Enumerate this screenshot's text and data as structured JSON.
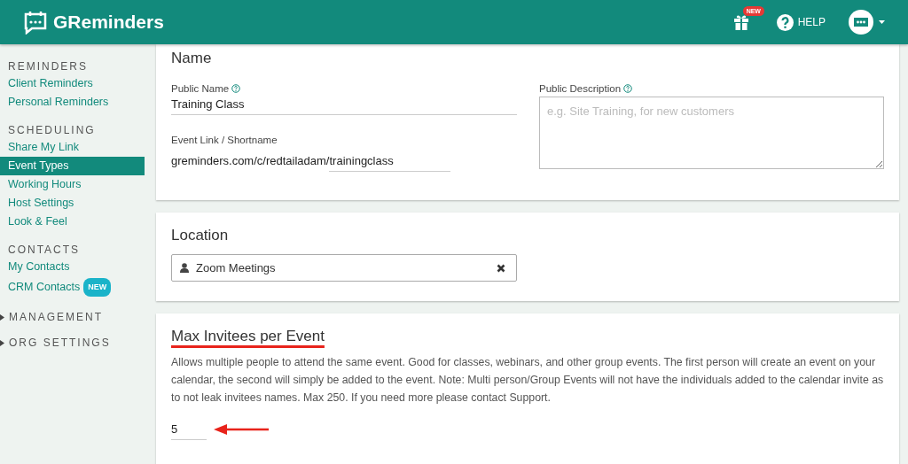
{
  "header": {
    "brand": "GReminders",
    "gift_badge": "NEW",
    "help": "HELP"
  },
  "sidebar": {
    "sections": [
      {
        "title": "REMINDERS",
        "items": [
          {
            "label": "Client Reminders",
            "selected": false
          },
          {
            "label": "Personal Reminders",
            "selected": false
          }
        ]
      },
      {
        "title": "SCHEDULING",
        "items": [
          {
            "label": "Share My Link",
            "selected": false
          },
          {
            "label": "Event Types",
            "selected": true
          },
          {
            "label": "Working Hours",
            "selected": false
          },
          {
            "label": "Host Settings",
            "selected": false
          },
          {
            "label": "Look & Feel",
            "selected": false
          }
        ]
      },
      {
        "title": "CONTACTS",
        "items": [
          {
            "label": "My Contacts",
            "selected": false
          },
          {
            "label": "CRM Contacts",
            "selected": false,
            "badge": "NEW"
          }
        ]
      }
    ],
    "groups": [
      {
        "label": "MANAGEMENT",
        "expanded": false
      },
      {
        "label": "ORG SETTINGS",
        "expanded": false
      }
    ]
  },
  "name_card": {
    "title": "Name",
    "public_name": {
      "label": "Public Name",
      "value": "Training Class"
    },
    "event_link": {
      "label": "Event Link / Shortname",
      "prefix": "greminders.com/c/redtailadam/",
      "value": "trainingclass"
    },
    "public_description": {
      "label": "Public Description",
      "placeholder": "e.g. Site Training, for new customers"
    }
  },
  "location_card": {
    "title": "Location",
    "value": "Zoom Meetings"
  },
  "invitees_card": {
    "title": "Max Invitees per Event",
    "description": "Allows multiple people to attend the same event. Good for classes, webinars, and other group events. The first person will create an event on your calendar, the second will simply be added to the event. Note: Multi person/Group Events will not have the individuals added to the calendar invite as to not leak invitees names. Max 250. If you need more please contact Support.",
    "value": "5"
  }
}
